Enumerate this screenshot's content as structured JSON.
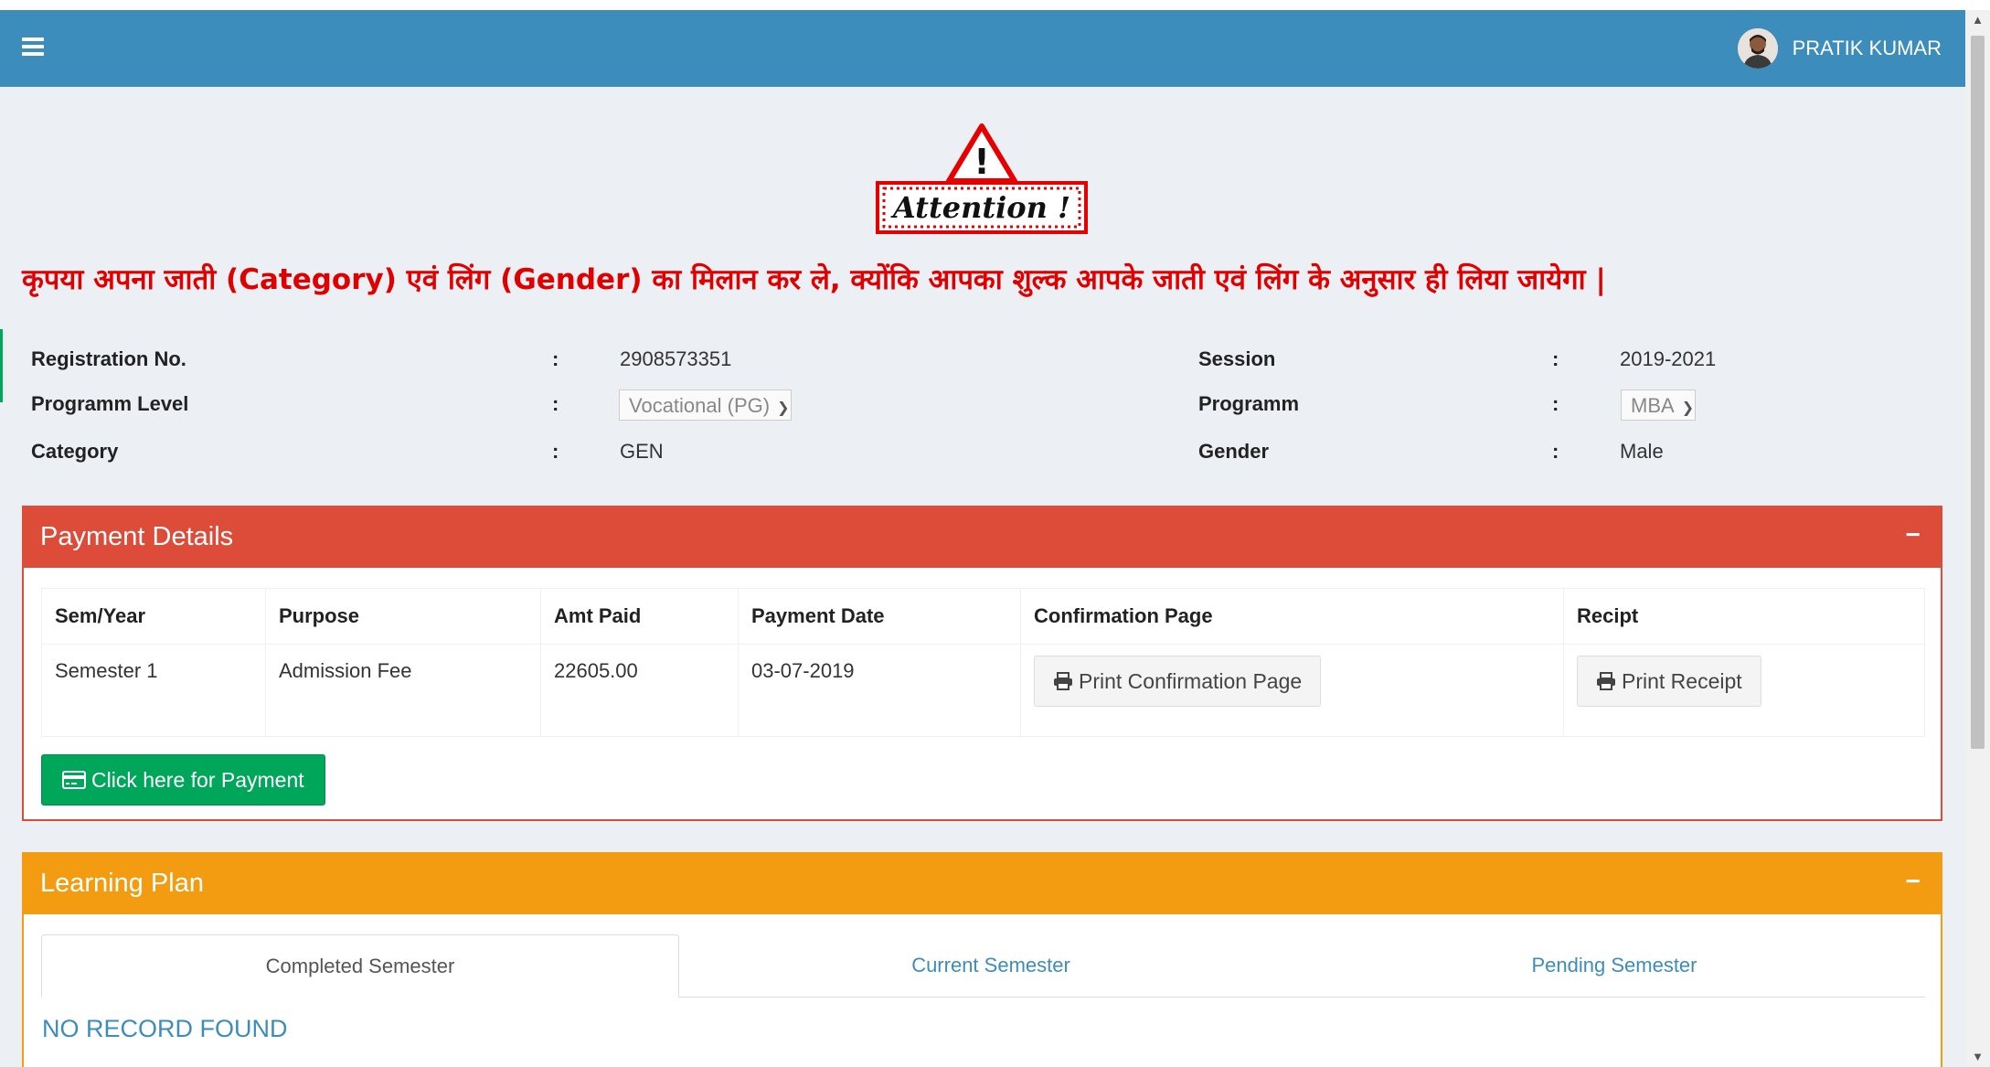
{
  "navbar": {
    "menu_icon": "hamburger-icon",
    "user_name": "PRATIK KUMAR",
    "avatar_icon": "user-avatar"
  },
  "attention": {
    "text": "Attention !",
    "icon": "warning-triangle-icon"
  },
  "notice": "कृपया अपना जाती (Category) एवं लिंग (Gender) का मिलान कर ले, क्योंकि आपका शुल्क आपके जाती एवं लिंग के अनुसार ही लिया जायेगा |",
  "student_info": {
    "separator": ":",
    "registration_label": "Registration No.",
    "registration_value": "2908573351",
    "session_label": "Session",
    "session_value": "2019-2021",
    "programm_level_label": "Programm Level",
    "programm_level_value": "Vocational (PG)",
    "programm_label": "Programm",
    "programm_value": "MBA",
    "category_label": "Category",
    "category_value": "GEN",
    "gender_label": "Gender",
    "gender_value": "Male"
  },
  "payment": {
    "title": "Payment Details",
    "collapse": "−",
    "headers": [
      "Sem/Year",
      "Purpose",
      "Amt Paid",
      "Payment Date",
      "Confirmation Page",
      "Recipt"
    ],
    "rows": [
      {
        "sem": "Semester 1",
        "purpose": "Admission Fee",
        "amount": "22605.00",
        "date": "03-07-2019",
        "confirm_button": "Print Confirmation Page",
        "receipt_button": "Print Receipt"
      }
    ],
    "pay_button": "Click here for Payment"
  },
  "learning_plan": {
    "title": "Learning Plan",
    "collapse": "−",
    "tabs": [
      "Completed Semester",
      "Current Semester",
      "Pending Semester"
    ],
    "active_tab": "Completed Semester",
    "empty_message": "NO RECORD FOUND"
  },
  "colors": {
    "navbar": "#3c8dbc",
    "danger": "#dd4b39",
    "warning": "#f39c12",
    "success": "#00a65a",
    "notice": "#e00000"
  }
}
